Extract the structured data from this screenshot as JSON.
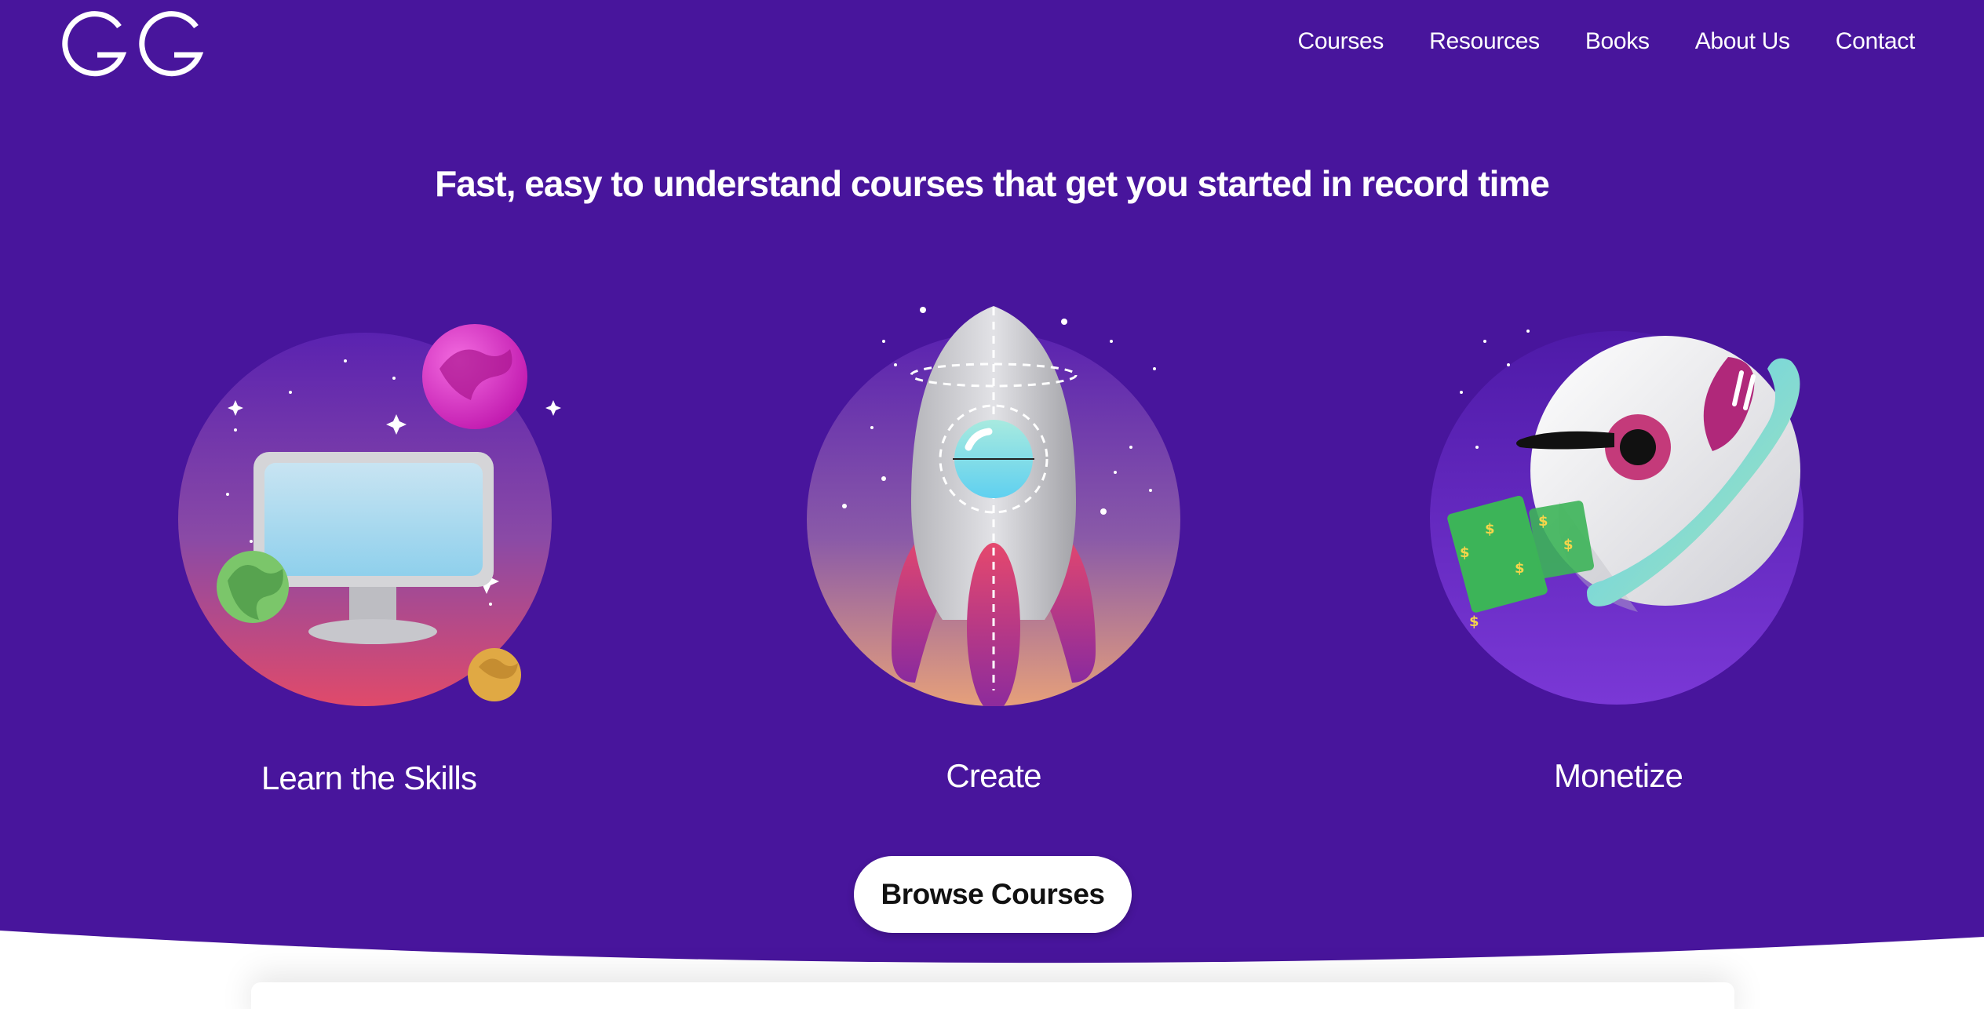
{
  "brand": {
    "logo_text": "GG"
  },
  "nav": {
    "items": [
      "Courses",
      "Resources",
      "Books",
      "About Us",
      "Contact"
    ]
  },
  "hero": {
    "headline": "Fast, easy to understand courses that get you started in record time",
    "features": [
      {
        "label": "Learn the Skills",
        "icon": "computer-planets-illustration"
      },
      {
        "label": "Create",
        "icon": "rocket-illustration"
      },
      {
        "label": "Monetize",
        "icon": "astronaut-money-illustration"
      }
    ],
    "cta_label": "Browse Courses"
  },
  "colors": {
    "background": "#48159c",
    "text": "#ffffff",
    "button_bg": "#ffffff",
    "button_text": "#111111"
  }
}
